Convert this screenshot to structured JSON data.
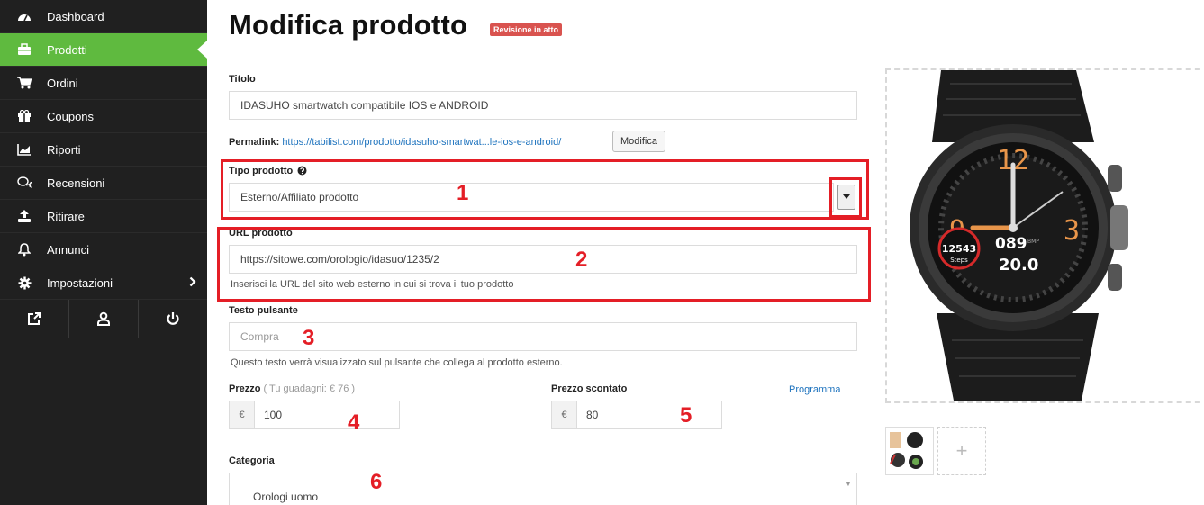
{
  "sidebar": {
    "items": [
      {
        "label": "Dashboard",
        "icon": "dashboard-icon"
      },
      {
        "label": "Prodotti",
        "icon": "briefcase-icon",
        "active": true
      },
      {
        "label": "Ordini",
        "icon": "cart-icon"
      },
      {
        "label": "Coupons",
        "icon": "gift-icon"
      },
      {
        "label": "Riporti",
        "icon": "chart-icon"
      },
      {
        "label": "Recensioni",
        "icon": "comments-icon"
      },
      {
        "label": "Ritirare",
        "icon": "upload-icon"
      },
      {
        "label": "Annunci",
        "icon": "bell-icon"
      },
      {
        "label": "Impostazioni",
        "icon": "gear-icon"
      }
    ],
    "tools": [
      "external-link-icon",
      "user-icon",
      "power-icon"
    ]
  },
  "header": {
    "title": "Modifica prodotto",
    "status_badge": "Revisione in atto"
  },
  "form": {
    "title_label": "Titolo",
    "title_value": "IDASUHO smartwatch compatibile IOS e ANDROID",
    "permalink_label": "Permalink:",
    "permalink_url": "https://tabilist.com/prodotto/idasuho-smartwat...le-ios-e-android/",
    "permalink_edit": "Modifica",
    "type_label": "Tipo prodotto",
    "type_value": "Esterno/Affiliato prodotto",
    "url_label": "URL prodotto",
    "url_value": "https://sitowe.com/orologio/idasuo/1235/2",
    "url_help": "Inserisci la URL del sito web esterno in cui si trova il tuo prodotto",
    "button_text_label": "Testo pulsante",
    "button_text_placeholder": "Compra",
    "button_text_help": "Questo testo verrà visualizzato sul pulsante che collega al prodotto esterno.",
    "price_label": "Prezzo",
    "price_earnings": "( Tu guadagni: € 76 )",
    "price_currency": "€",
    "price_value": "100",
    "sale_label": "Prezzo scontato",
    "sale_currency": "€",
    "sale_value": "80",
    "schedule_link": "Programma",
    "category_label": "Categoria",
    "category_value": "Orologi uomo"
  },
  "annotations": [
    "1",
    "2",
    "3",
    "4",
    "5",
    "6"
  ],
  "watch_display": {
    "steps": "12543",
    "steps_label": "Steps",
    "heart": "089",
    "heart_unit": "BMP",
    "temp": "20.0",
    "hour_left": "9",
    "hour_right": "3",
    "hour_top": "12"
  },
  "gallery": {
    "add_symbol": "+"
  },
  "colors": {
    "sidebar_bg": "#202020",
    "active": "#5fba3f",
    "badge": "#d9534f",
    "annotation": "#e41e26",
    "link": "#1e73be"
  }
}
